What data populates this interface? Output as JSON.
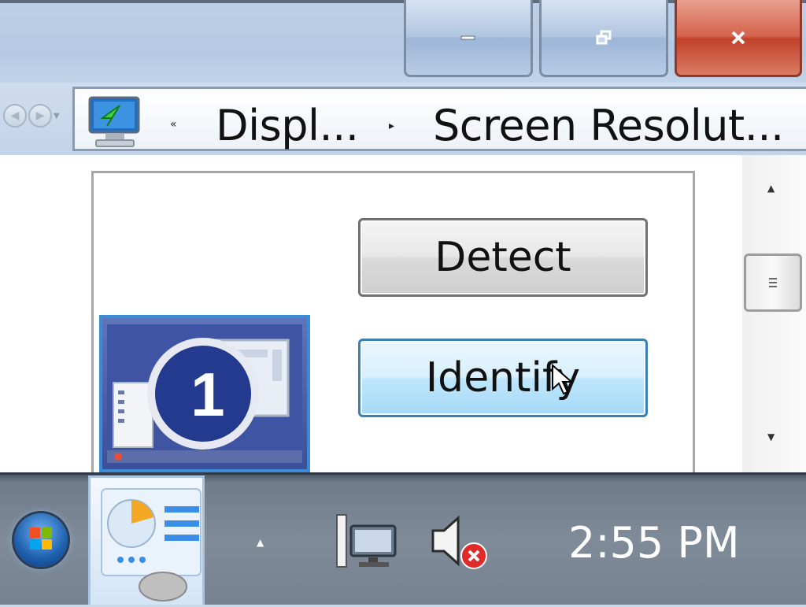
{
  "window": {
    "minimize_icon": "minimize-icon",
    "restore_icon": "restore-icon",
    "close_icon": "close-icon"
  },
  "nav": {
    "back_icon": "back-arrow-icon",
    "forward_icon": "forward-arrow-icon",
    "recent_icon": "chevron-down-icon"
  },
  "address": {
    "icon": "display-control-panel-icon",
    "overflow_marker": "«",
    "crumbs": [
      "Displ...",
      "Screen Resolut..."
    ]
  },
  "main": {
    "detect_label": "Detect",
    "identify_label": "Identify",
    "monitor_number": "1"
  },
  "taskbar": {
    "clock": "2:55 PM",
    "tray_expand_icon": "chevron-up-icon",
    "network_icon": "network-icon",
    "volume_icon": "volume-muted-icon"
  },
  "colors": {
    "accent_blue": "#3b8bd6",
    "close_red": "#c1412a",
    "taskbar": "#7f8b99"
  }
}
